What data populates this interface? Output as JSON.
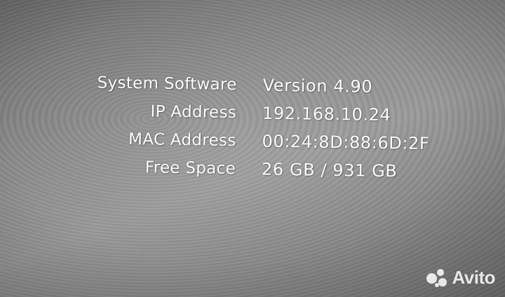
{
  "system_info": {
    "rows": [
      {
        "label": "System Software",
        "value": "Version 4.90"
      },
      {
        "label": "IP Address",
        "value": "192.168.10.24"
      },
      {
        "label": "MAC Address",
        "value": "00:24:8D:88:6D:2F"
      },
      {
        "label": "Free Space",
        "value": "26 GB / 931 GB"
      }
    ]
  },
  "watermark": {
    "text": "Avito",
    "icon": "avito-dots-icon"
  },
  "colors": {
    "text": "#ffffff",
    "background": "#8c8c8c"
  }
}
